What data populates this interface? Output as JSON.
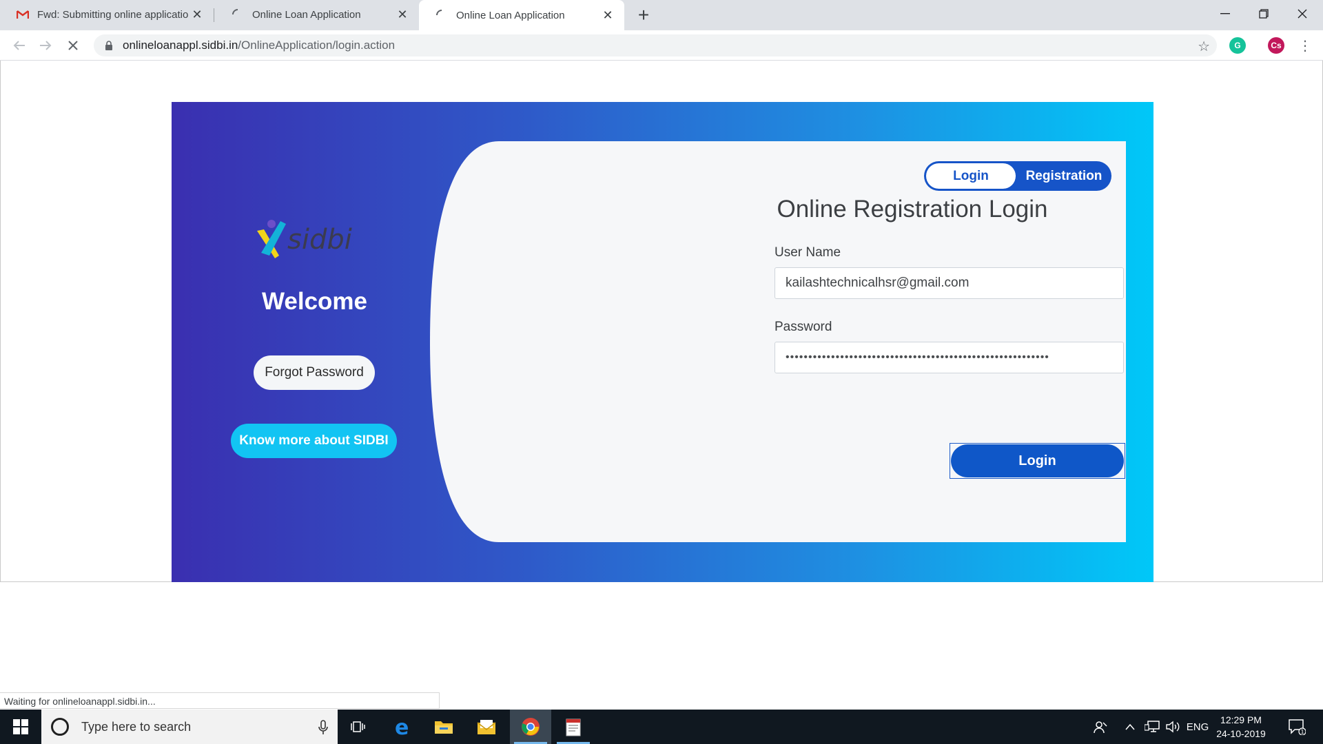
{
  "browser": {
    "tabs": [
      {
        "title": "Fwd: Submitting online applicatio",
        "icon": "gmail-icon"
      },
      {
        "title": "Online Loan Application",
        "icon": "loading-spinner-icon"
      },
      {
        "title": "Online Loan Application",
        "icon": "loading-spinner-icon",
        "active": true
      }
    ],
    "new_tab_glyph": "+",
    "url_host": "onlineloanappl.sidbi.in",
    "url_path": "/OnlineApplication/login.action",
    "profile_initials": "Cs",
    "status_text": "Waiting for onlineloanappl.sidbi.in..."
  },
  "page": {
    "brand": "sidbi",
    "welcome": "Welcome",
    "forgot_password": "Forgot Password",
    "know_more": "Know more about SIDBI",
    "toggle": {
      "login": "Login",
      "registration": "Registration",
      "selected": "Login"
    },
    "title": "Online Registration Login",
    "username_label": "User Name",
    "username_value": "kailashtechnicalhsr@gmail.com",
    "password_label": "Password",
    "password_value": "••••••••••••••••••••••••••••••••••••••••••••••••••••••••••",
    "login_button": "Login",
    "colors": {
      "accent": "#0f57c8",
      "cyan": "#12c4f3",
      "gradient_start": "#3a2fb0",
      "gradient_end": "#00c8f8"
    }
  },
  "taskbar": {
    "search_placeholder": "Type here to search",
    "apps": [
      "task-view-icon",
      "edge-icon",
      "file-explorer-icon",
      "mail-folder-icon",
      "chrome-icon",
      "notepad-icon"
    ],
    "language": "ENG",
    "time": "12:29 PM",
    "date": "24-10-2019",
    "notification_count": "1"
  }
}
